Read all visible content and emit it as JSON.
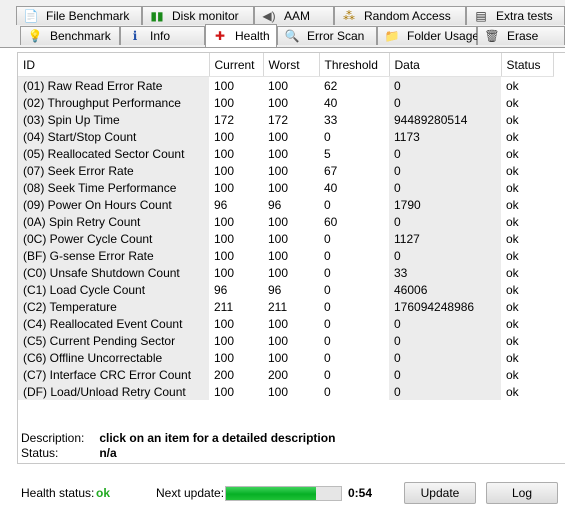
{
  "tabs_row1": [
    {
      "label": "File Benchmark",
      "icon": "file-benchmark-icon"
    },
    {
      "label": "Disk monitor",
      "icon": "disk-monitor-icon"
    },
    {
      "label": "AAM",
      "icon": "speaker-icon"
    },
    {
      "label": "Random Access",
      "icon": "random-access-icon"
    },
    {
      "label": "Extra tests",
      "icon": "extra-tests-icon"
    }
  ],
  "tabs_row2": [
    {
      "label": "Benchmark",
      "icon": "lightbulb-icon"
    },
    {
      "label": "Info",
      "icon": "info-icon"
    },
    {
      "label": "Health",
      "icon": "health-cross-icon"
    },
    {
      "label": "Error Scan",
      "icon": "magnifier-icon"
    },
    {
      "label": "Folder Usage",
      "icon": "folder-icon"
    },
    {
      "label": "Erase",
      "icon": "trash-icon"
    }
  ],
  "table": {
    "columns": [
      "ID",
      "Current",
      "Worst",
      "Threshold",
      "Data",
      "Status"
    ],
    "rows": [
      [
        "(01) Raw Read Error Rate",
        "100",
        "100",
        "62",
        "0",
        "ok"
      ],
      [
        "(02) Throughput Performance",
        "100",
        "100",
        "40",
        "0",
        "ok"
      ],
      [
        "(03) Spin Up Time",
        "172",
        "172",
        "33",
        "94489280514",
        "ok"
      ],
      [
        "(04) Start/Stop Count",
        "100",
        "100",
        "0",
        "1173",
        "ok"
      ],
      [
        "(05) Reallocated Sector Count",
        "100",
        "100",
        "5",
        "0",
        "ok"
      ],
      [
        "(07) Seek Error Rate",
        "100",
        "100",
        "67",
        "0",
        "ok"
      ],
      [
        "(08) Seek Time Performance",
        "100",
        "100",
        "40",
        "0",
        "ok"
      ],
      [
        "(09) Power On Hours Count",
        "96",
        "96",
        "0",
        "1790",
        "ok"
      ],
      [
        "(0A) Spin Retry Count",
        "100",
        "100",
        "60",
        "0",
        "ok"
      ],
      [
        "(0C) Power Cycle Count",
        "100",
        "100",
        "0",
        "1127",
        "ok"
      ],
      [
        "(BF) G-sense Error Rate",
        "100",
        "100",
        "0",
        "0",
        "ok"
      ],
      [
        "(C0) Unsafe Shutdown Count",
        "100",
        "100",
        "0",
        "33",
        "ok"
      ],
      [
        "(C1) Load Cycle Count",
        "96",
        "96",
        "0",
        "46006",
        "ok"
      ],
      [
        "(C2) Temperature",
        "211",
        "211",
        "0",
        "176094248986",
        "ok"
      ],
      [
        "(C4) Reallocated Event Count",
        "100",
        "100",
        "0",
        "0",
        "ok"
      ],
      [
        "(C5) Current Pending Sector",
        "100",
        "100",
        "0",
        "0",
        "ok"
      ],
      [
        "(C6) Offline Uncorrectable",
        "100",
        "100",
        "0",
        "0",
        "ok"
      ],
      [
        "(C7) Interface CRC Error Count",
        "200",
        "200",
        "0",
        "0",
        "ok"
      ],
      [
        "(DF) Load/Unload Retry Count",
        "100",
        "100",
        "0",
        "0",
        "ok"
      ]
    ]
  },
  "description": {
    "label": "Description:",
    "value": "click on an item for a detailed description"
  },
  "status": {
    "label": "Status:",
    "value": "n/a"
  },
  "health": {
    "label": "Health status:",
    "value": "ok",
    "color": "#22aa22"
  },
  "next_update": {
    "label": "Next update:",
    "progress": 0.78,
    "time": "0:54"
  },
  "buttons": {
    "update": "Update",
    "log": "Log"
  }
}
